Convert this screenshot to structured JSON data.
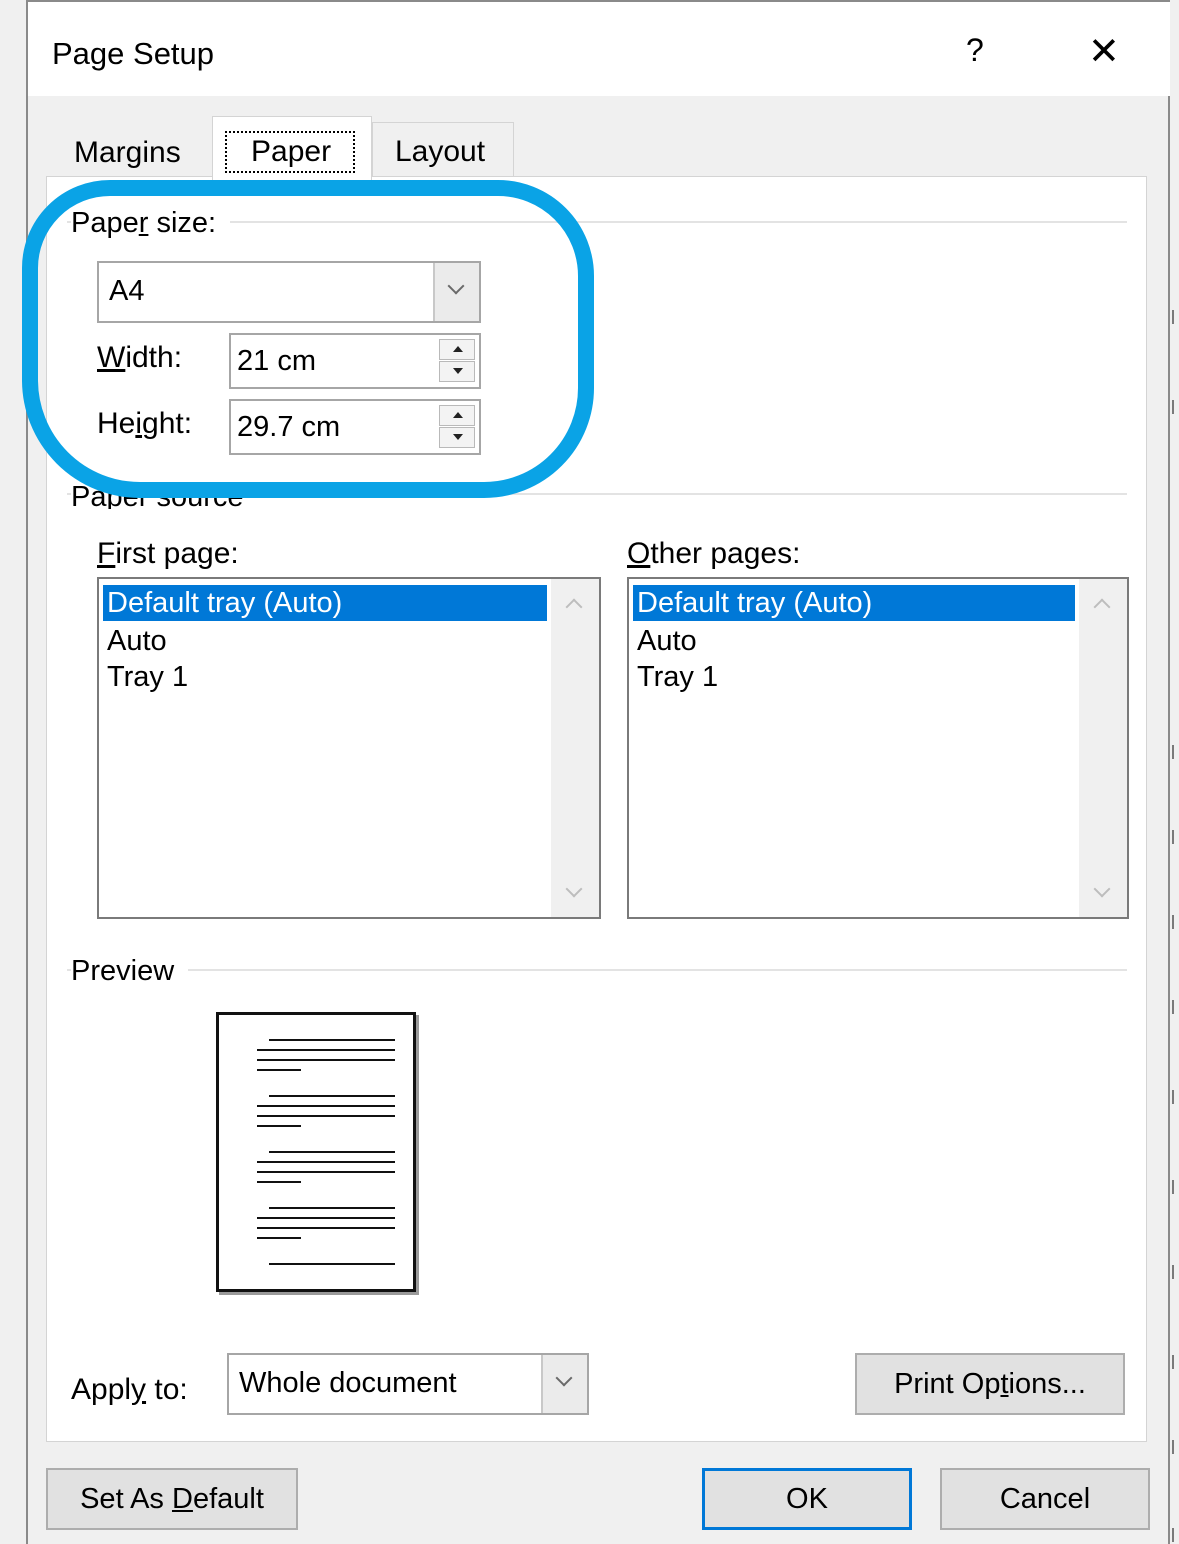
{
  "window": {
    "title": "Page Setup",
    "help_label": "?",
    "close_label": "✕"
  },
  "tabs": [
    {
      "label": "Margins"
    },
    {
      "label": "Paper"
    },
    {
      "label": "Layout"
    }
  ],
  "paper_size": {
    "group_label_pre": "Pape",
    "group_label_u": "r",
    "group_label_post": " size:",
    "selected": "A4",
    "width_label_u": "W",
    "width_label_rest": "idth:",
    "width_value": "21 cm",
    "height_label_pre": "He",
    "height_label_u": "i",
    "height_label_post": "ght:",
    "height_value": "29.7 cm"
  },
  "paper_source": {
    "group_label": "Paper source",
    "first_page": {
      "label_u": "F",
      "label_rest": "irst page:",
      "items": [
        "Default tray (Auto)",
        "Auto",
        "Tray 1"
      ],
      "selected_index": 0
    },
    "other_pages": {
      "label_u": "O",
      "label_rest": "ther pages:",
      "items": [
        "Default tray (Auto)",
        "Auto",
        "Tray 1"
      ],
      "selected_index": 0
    }
  },
  "preview": {
    "group_label": "Preview"
  },
  "apply_to": {
    "label_pre": "Appl",
    "label_u": "y",
    "label_post": " to:",
    "selected": "Whole document"
  },
  "buttons": {
    "print_options_pre": "Print Op",
    "print_options_u": "t",
    "print_options_post": "ions...",
    "set_default_pre": "Set As ",
    "set_default_u": "D",
    "set_default_post": "efault",
    "ok": "OK",
    "cancel": "Cancel"
  },
  "colors": {
    "selection": "#0078d7",
    "highlight_ring": "#0aa3e6",
    "dialog_bg": "#f0f0f0"
  }
}
